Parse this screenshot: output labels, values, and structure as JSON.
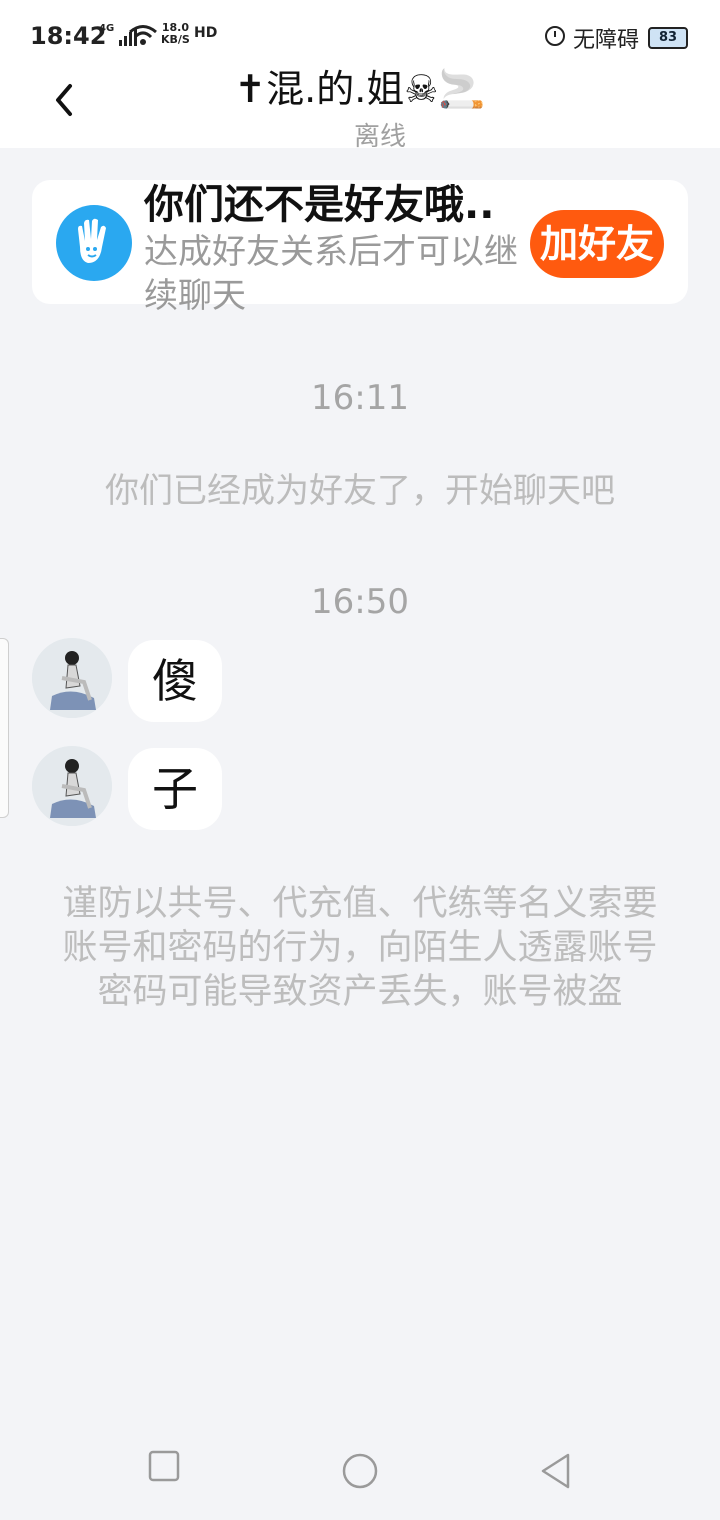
{
  "status_bar": {
    "time": "18:42",
    "network": "4G",
    "speed_value": "18.0",
    "speed_unit": "KB/S",
    "hd": "HD",
    "accessibility": "无障碍",
    "battery": "83"
  },
  "header": {
    "title": "✝混.的.姐☠🚬",
    "subtitle": "离线",
    "back_icon": "chevron-left-icon"
  },
  "friend_card": {
    "icon": "wave-hand-icon",
    "heading": "你们还不是好友哦..",
    "description": "达成好友关系后才可以继续聊天",
    "button_label": "加好友",
    "accent": "#ff5a0f",
    "icon_color": "#2aa8f0"
  },
  "chat": {
    "time_1": "16:11",
    "system_message": "你们已经成为好友了，开始聊天吧",
    "time_2": "16:50",
    "messages": [
      {
        "text": "傻"
      },
      {
        "text": "子"
      }
    ],
    "warning": "谨防以共号、代充值、代练等名义索要账号和密码的行为，向陌生人透露账号密码可能导致资产丢失，账号被盗"
  },
  "nav_bar": {
    "recents_icon": "square-icon",
    "home_icon": "circle-icon",
    "back_icon": "triangle-back-icon"
  }
}
